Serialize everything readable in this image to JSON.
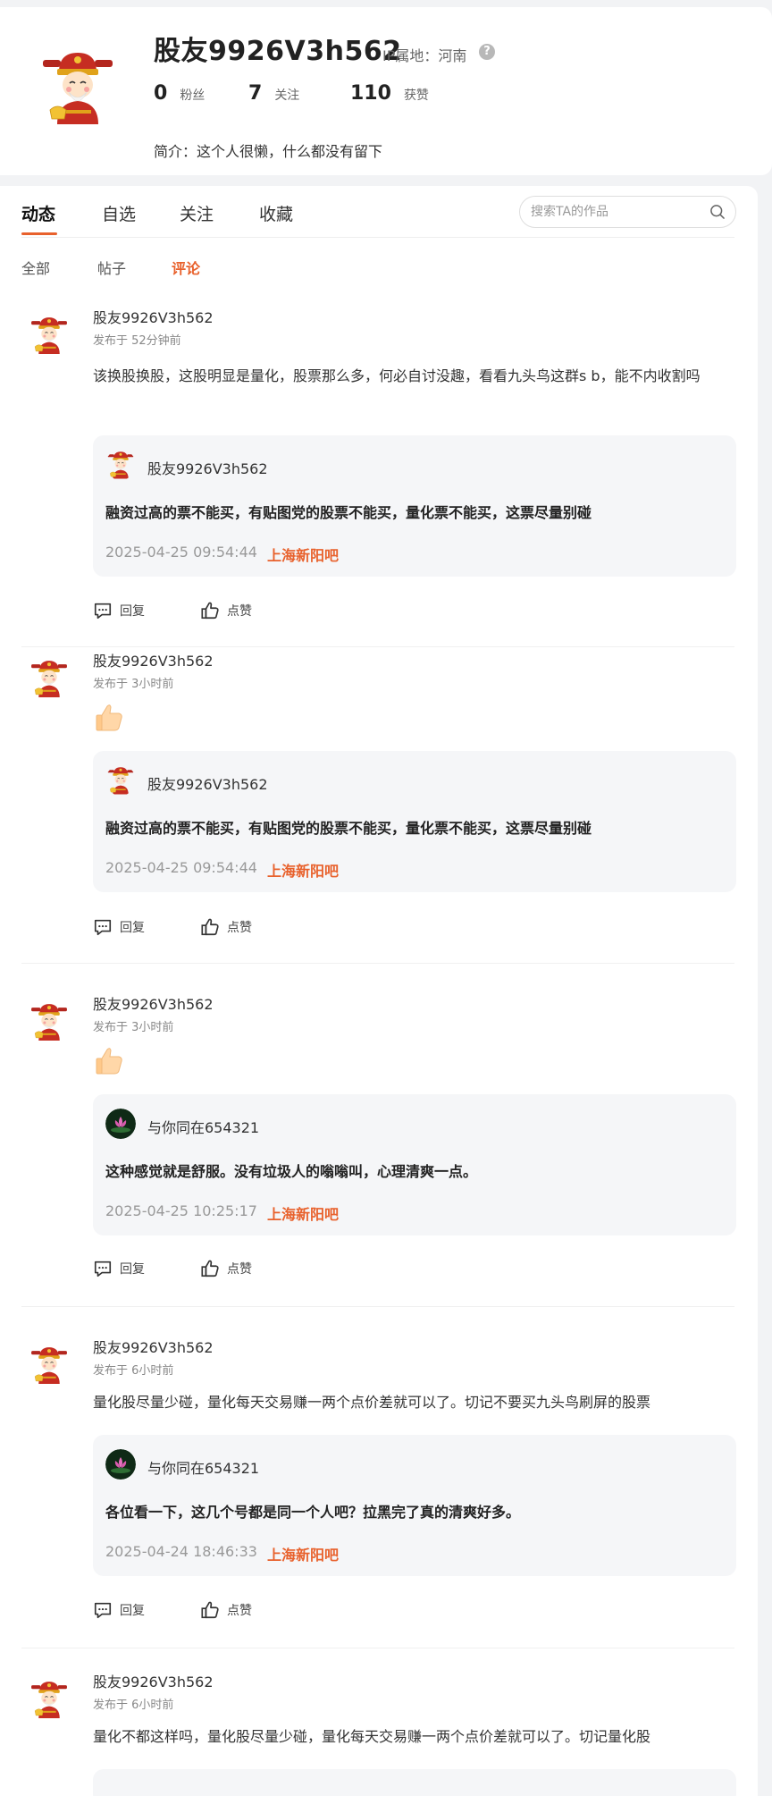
{
  "profile": {
    "username": "股友9926V3h562",
    "ip_label": "IP属地：河南",
    "help_glyph": "?",
    "stats": [
      {
        "num": "0",
        "label": "粉丝"
      },
      {
        "num": "7",
        "label": "关注"
      },
      {
        "num": "110",
        "label": "获赞"
      }
    ],
    "bio": "简介：这个人很懒，什么都没有留下"
  },
  "tabs": [
    "动态",
    "自选",
    "关注",
    "收藏"
  ],
  "search": {
    "placeholder": "搜索TA的作品"
  },
  "subtabs": [
    "全部",
    "帖子",
    "评论"
  ],
  "actions": {
    "reply": "回复",
    "like": "点赞"
  },
  "posts": [
    {
      "author": "股友9926V3h562",
      "time": "发布于 52分钟前",
      "content": "该换股换股，这股明显是量化，股票那么多，何必自讨没趣，看看九头鸟这群s b，能不内收割吗",
      "quote": {
        "author": "股友9926V3h562",
        "text": "融资过高的票不能买，有贴图党的股票不能买，量化票不能买，这票尽量别碰",
        "date": "2025-04-25 09:54:44",
        "bar": "上海新阳吧"
      }
    },
    {
      "author": "股友9926V3h562",
      "time": "发布于 3小时前",
      "content_emoji": "thumbs-up",
      "quote": {
        "author": "股友9926V3h562",
        "text": "融资过高的票不能买，有贴图党的股票不能买，量化票不能买，这票尽量别碰",
        "date": "2025-04-25 09:54:44",
        "bar": "上海新阳吧"
      }
    },
    {
      "author": "股友9926V3h562",
      "time": "发布于 3小时前",
      "content_emoji": "thumbs-up",
      "quote": {
        "author": "与你同在654321",
        "text": "这种感觉就是舒服。没有垃圾人的嗡嗡叫，心理清爽一点。",
        "date": "2025-04-25 10:25:17",
        "bar": "上海新阳吧"
      }
    },
    {
      "author": "股友9926V3h562",
      "time": "发布于 6小时前",
      "content": "量化股尽量少碰，量化每天交易赚一两个点价差就可以了。切记不要买九头鸟刷屏的股票",
      "quote": {
        "author": "与你同在654321",
        "text": "各位看一下，这几个号都是同一个人吧？拉黑完了真的清爽好多。",
        "date": "2025-04-24 18:46:33",
        "bar": "上海新阳吧"
      }
    },
    {
      "author": "股友9926V3h562",
      "time": "发布于 6小时前",
      "content": "量化不都这样吗，量化股尽量少碰，量化每天交易赚一两个点价差就可以了。切记量化股"
    }
  ]
}
